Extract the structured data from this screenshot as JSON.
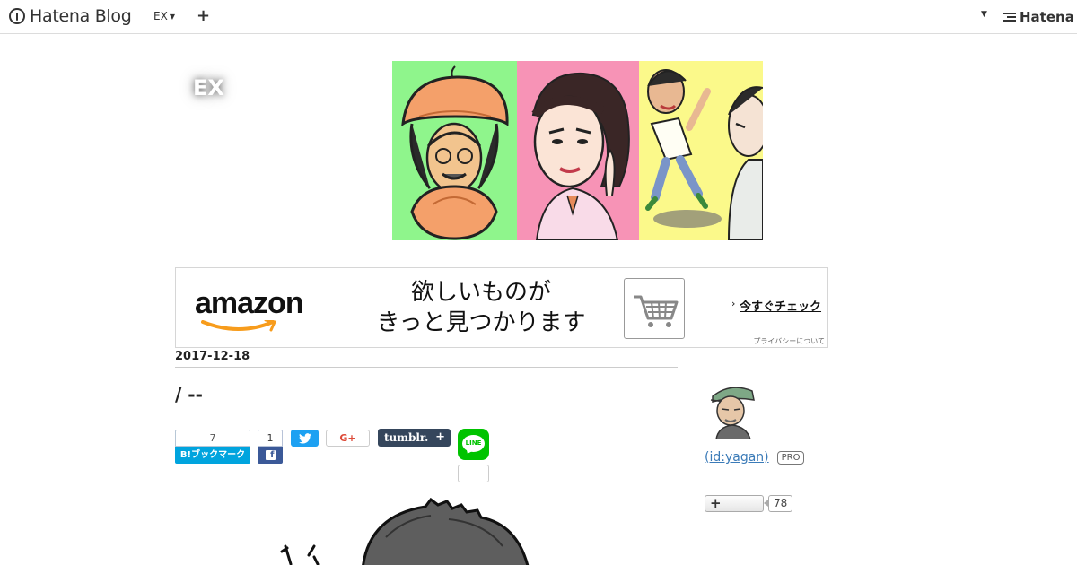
{
  "topbar": {
    "brand_name": "Hatena Blog",
    "blog_switch_label": "EX",
    "add_label": "+",
    "right_logo": "Hatena",
    "icons": [
      "hatena-blog-logo-icon",
      "caret-down-icon",
      "plus-icon",
      "hatena-logo-icon"
    ]
  },
  "header": {
    "blog_title": "EX"
  },
  "ad": {
    "brand": "amazon",
    "copy_line1": "欲しいものが",
    "copy_line2": "きっと見つかります",
    "cta": "今すぐチェック",
    "privacy": "プライバシーについて",
    "icons": [
      "shopping-cart-icon"
    ],
    "colors": {
      "smile": "#f79c1c"
    }
  },
  "entry": {
    "date": "2017-12-18",
    "title": "/  --"
  },
  "share": {
    "hatena_count": "7",
    "hatena_label": "B!ブックマーク",
    "facebook_count": "1",
    "google_plus_label": "G+",
    "tumblr_label": "tumblr.",
    "tumblr_plus": "+",
    "line_label": "LINE",
    "colors": {
      "hatena": "#00a4de",
      "facebook": "#3b5998",
      "twitter": "#1da1f2",
      "tumblr": "#35465c",
      "line": "#00c300"
    }
  },
  "sidebar": {
    "profile_id": " (id:yagan)",
    "pro_badge": "PRO",
    "follow_plus": "+",
    "follower_count": "78"
  }
}
